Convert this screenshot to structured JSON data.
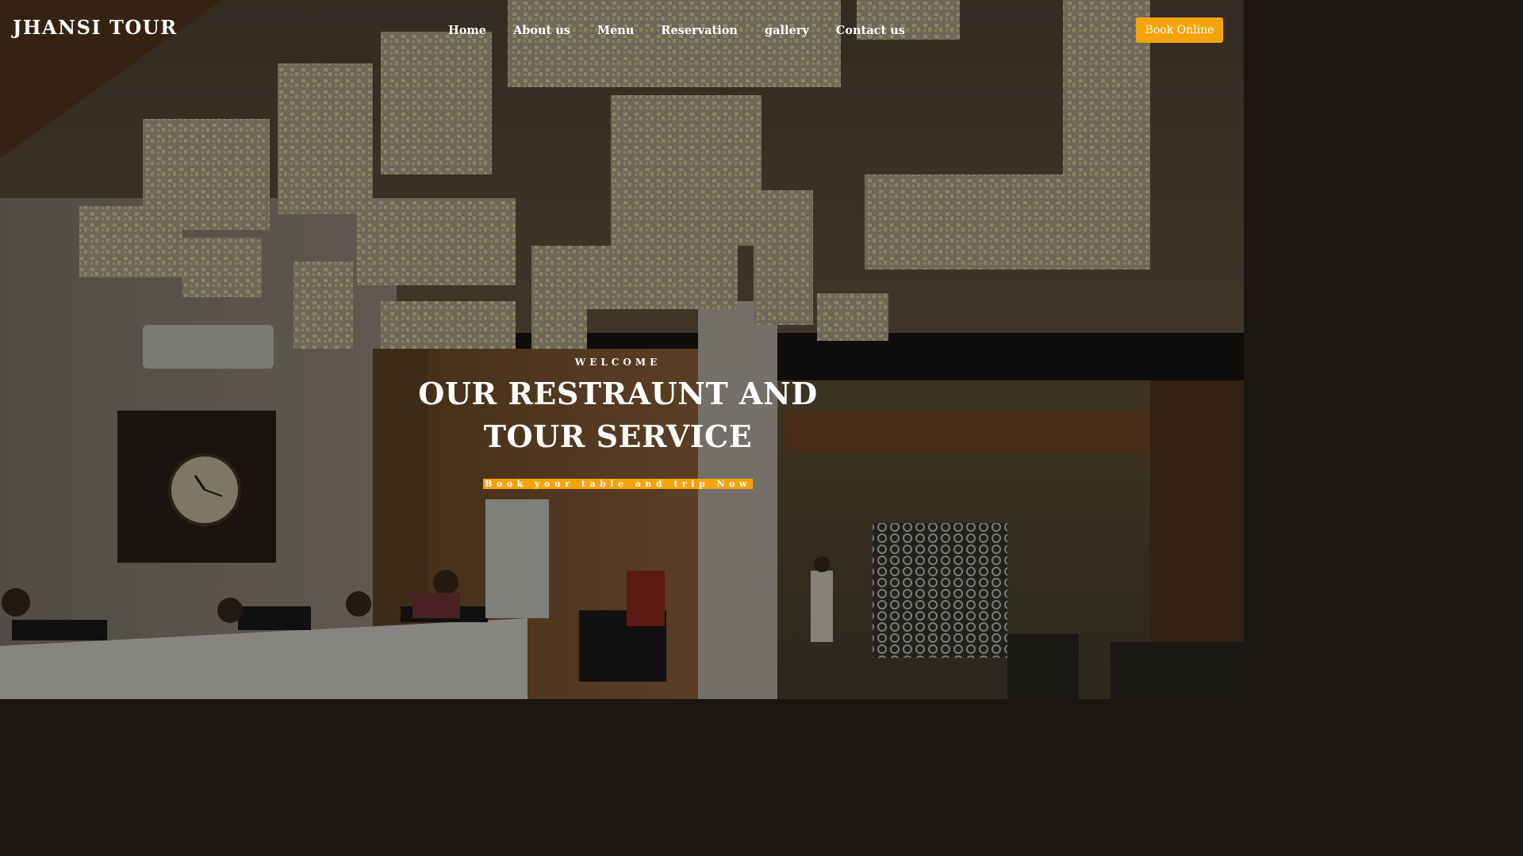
{
  "brand": {
    "name": "JHANSI TOUR"
  },
  "nav": {
    "items": [
      {
        "label": "Home"
      },
      {
        "label": "About us"
      },
      {
        "label": "Menu"
      },
      {
        "label": "Reservation"
      },
      {
        "label": "gallery"
      },
      {
        "label": "Contact us"
      }
    ],
    "cta_label": "Book Online"
  },
  "hero": {
    "eyebrow": "WELCOME",
    "headline": "OUR RESTRAUNT AND TOUR SERVICE",
    "cta_text": "Book your table and trip Now",
    "background": "hotel-lobby-photo"
  },
  "colors": {
    "accent": "#f5a30b",
    "text": "#ffffff"
  }
}
